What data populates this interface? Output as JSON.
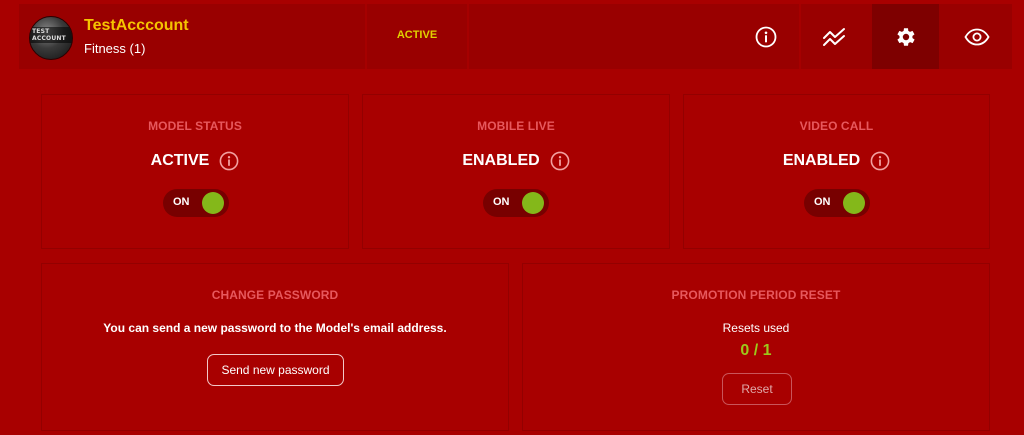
{
  "account": {
    "avatar_text": "TEST ACCOUNT",
    "name": "TestAcccount",
    "category": "Fitness (1)",
    "status": "ACTIVE"
  },
  "nav": {
    "items": [
      {
        "icon": "info-icon",
        "active": false
      },
      {
        "icon": "trend-icon",
        "active": false
      },
      {
        "icon": "gear-icon",
        "active": true
      },
      {
        "icon": "eye-icon",
        "active": false
      }
    ]
  },
  "model_status": {
    "title": "MODEL STATUS",
    "value": "ACTIVE",
    "toggle_label": "ON"
  },
  "mobile_live": {
    "title": "MOBILE LIVE",
    "value": "ENABLED",
    "toggle_label": "ON"
  },
  "video_call": {
    "title": "VIDEO CALL",
    "value": "ENABLED",
    "toggle_label": "ON"
  },
  "change_password": {
    "title": "CHANGE PASSWORD",
    "description": "You can send a new password to the Model's email address.",
    "button_label": "Send new password"
  },
  "promotion_reset": {
    "title": "PROMOTION PERIOD RESET",
    "resets_label": "Resets used",
    "resets_value": "0 / 1",
    "button_label": "Reset"
  },
  "colors": {
    "background": "#a80000",
    "panel": "#990000",
    "accent_yellow": "#f5c400",
    "status_yellow": "#e0d000",
    "toggle_green": "#84b81a",
    "value_green": "#9dc81b",
    "muted_title": "#e7585d"
  }
}
